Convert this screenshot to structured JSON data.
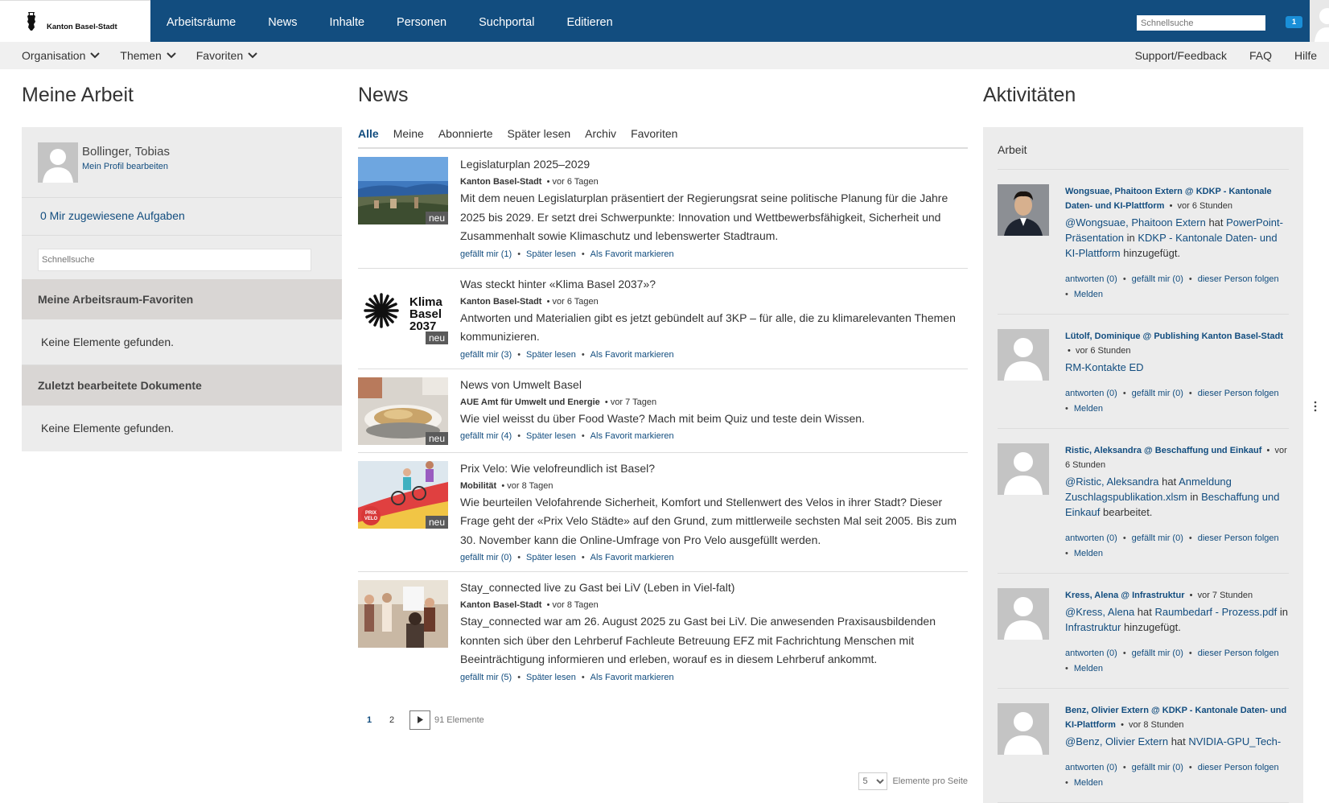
{
  "header": {
    "logo_text": "Kanton Basel-Stadt",
    "nav": [
      "Arbeitsräume",
      "News",
      "Inhalte",
      "Personen",
      "Suchportal",
      "Editieren"
    ],
    "search_placeholder": "Schnellsuche",
    "notification_count": "1"
  },
  "subnav": {
    "left": [
      "Organisation",
      "Themen",
      "Favoriten"
    ],
    "right": [
      "Support/Feedback",
      "FAQ",
      "Hilfe"
    ]
  },
  "meine_arbeit": {
    "title": "Meine Arbeit",
    "user_name": "Bollinger, Tobias",
    "profile_link": "Mein Profil bearbeiten",
    "tasks": "0 Mir zugewiesene Aufgaben",
    "search_placeholder": "Schnellsuche",
    "favorites_head": "Meine Arbeitsraum-Favoriten",
    "favorites_empty": "Keine Elemente gefunden.",
    "docs_head": "Zuletzt bearbeitete Dokumente",
    "docs_empty": "Keine Elemente gefunden."
  },
  "news": {
    "title": "News",
    "tabs": [
      "Alle",
      "Meine",
      "Abonnierte",
      "Später lesen",
      "Archiv",
      "Favoriten"
    ],
    "active_tab": "Alle",
    "badge": "neu",
    "items": [
      {
        "title": "Legislaturplan 2025–2029",
        "source": "Kanton Basel-Stadt",
        "time": "vor 6 Tagen",
        "text": "Mit dem neuen Legislaturplan präsentiert der Regierungsrat seine politische Planung für die Jahre 2025 bis 2029. Er setzt drei Schwerpunkte: Innovation und Wettbewerbsfähigkeit, Sicherheit und Zusammenhalt sowie Klimaschutz und lebenswerter Stadtraum.",
        "like": "gefällt mir (1)",
        "later": "Später lesen",
        "fav": "Als Favorit markieren",
        "thumb": "city"
      },
      {
        "title": "Was steckt hinter «Klima Basel 2037»?",
        "source": "Kanton Basel-Stadt",
        "time": "vor 6 Tagen",
        "text": "Antworten und Materialien gibt es jetzt gebündelt auf 3KP – für alle, die zu klimarelevanten Themen kommunizieren.",
        "like": "gefällt mir (3)",
        "later": "Später lesen",
        "fav": "Als Favorit markieren",
        "thumb": "klima",
        "thumb_text": [
          "Klima",
          "Basel",
          "2037"
        ]
      },
      {
        "title": "News von Umwelt Basel",
        "source": "AUE Amt für Umwelt und Energie",
        "time": "vor 7 Tagen",
        "text": "Wie viel weisst du über Food Waste? Mach mit beim Quiz und teste dein Wissen.",
        "like": "gefällt mir (4)",
        "later": "Später lesen",
        "fav": "Als Favorit markieren",
        "thumb": "food"
      },
      {
        "title": "Prix Velo: Wie velofreundlich ist Basel?",
        "source": "Mobilität",
        "time": "vor 8 Tagen",
        "text": "Wie beurteilen Velofahrende Sicherheit, Komfort und Stellenwert des Velos in ihrer Stadt? Dieser Frage geht der «Prix Velo Städte» auf den Grund, zum mittlerweile sechsten Mal seit 2005. Bis zum 30. November kann die Online-Umfrage von Pro Velo ausgefüllt werden.",
        "like": "gefällt mir (0)",
        "later": "Später lesen",
        "fav": "Als Favorit markieren",
        "thumb": "velo",
        "thumb_text": [
          "PRIX",
          "VELO"
        ]
      },
      {
        "title": "Stay_connected live zu Gast bei LiV (Leben in Viel-falt)",
        "source": "Kanton Basel-Stadt",
        "time": "vor 8 Tagen",
        "text": "Stay_connected war am 26. August 2025 zu Gast bei LiV. Die anwesenden Praxisausbildenden konnten sich über den Lehrberuf Fachleute Betreuung EFZ mit Fachrichtung Menschen mit Beeinträchtigung informieren und erleben, worauf es in diesem Lehrberuf ankommt.",
        "like": "gefällt mir (5)",
        "later": "Später lesen",
        "fav": "Als Favorit markieren",
        "thumb": "people"
      }
    ],
    "pager": {
      "pages": [
        "1",
        "2"
      ],
      "count": "91 Elemente"
    },
    "per_page_value": "5",
    "per_page_label": "Elemente pro Seite"
  },
  "aktivitaeten": {
    "title": "Aktivitäten",
    "filter": "Arbeit",
    "items": [
      {
        "who": "Wongsuae, Phaitoon Extern @ KDKP - Kantonale Daten- und KI-Plattform",
        "time": "vor 6 Stunden",
        "text_parts": [
          {
            "t": "@Wongsuae, Phaitoon Extern",
            "link": true
          },
          {
            "t": " hat ",
            "link": false
          },
          {
            "t": "PowerPoint-Präsentation",
            "link": true
          },
          {
            "t": " in ",
            "link": false
          },
          {
            "t": "KDKP - Kantonale Daten- und KI-Plattform",
            "link": true
          },
          {
            "t": " hinzugefügt.",
            "link": false
          }
        ],
        "photo": true
      },
      {
        "who": "Lütolf, Dominique @ Publishing Kanton Basel-Stadt",
        "time": "vor 6 Stunden",
        "text_parts": [
          {
            "t": "RM-Kontakte ED",
            "link": true
          }
        ],
        "photo": false
      },
      {
        "who": "Ristic, Aleksandra @ Beschaffung und Einkauf",
        "time": "vor 6 Stunden",
        "text_parts": [
          {
            "t": "@Ristic, Aleksandra",
            "link": true
          },
          {
            "t": " hat ",
            "link": false
          },
          {
            "t": "Anmeldung Zuschlagspublikation.xlsm",
            "link": true
          },
          {
            "t": " in ",
            "link": false
          },
          {
            "t": "Beschaffung und Einkauf",
            "link": true
          },
          {
            "t": " bearbeitet.",
            "link": false
          }
        ],
        "photo": false
      },
      {
        "who": "Kress, Alena @ Infrastruktur",
        "time": "vor 7 Stunden",
        "text_parts": [
          {
            "t": "@Kress, Alena",
            "link": true
          },
          {
            "t": " hat ",
            "link": false
          },
          {
            "t": "Raumbedarf - Prozess.pdf",
            "link": true
          },
          {
            "t": " in ",
            "link": false
          },
          {
            "t": "Infrastruktur",
            "link": true
          },
          {
            "t": " hinzugefügt.",
            "link": false
          }
        ],
        "photo": false
      },
      {
        "who": "Benz, Olivier Extern @ KDKP - Kantonale Daten- und KI-Plattform",
        "time": "vor 8 Stunden",
        "text_parts": [
          {
            "t": "@Benz, Olivier Extern",
            "link": true
          },
          {
            "t": " hat ",
            "link": false
          },
          {
            "t": "NVIDIA-GPU_Tech-",
            "link": true
          }
        ],
        "photo": false
      }
    ],
    "actions": {
      "reply": "antworten (0)",
      "like": "gefällt mir (0)",
      "follow": "dieser Person folgen",
      "report": "Melden"
    }
  }
}
